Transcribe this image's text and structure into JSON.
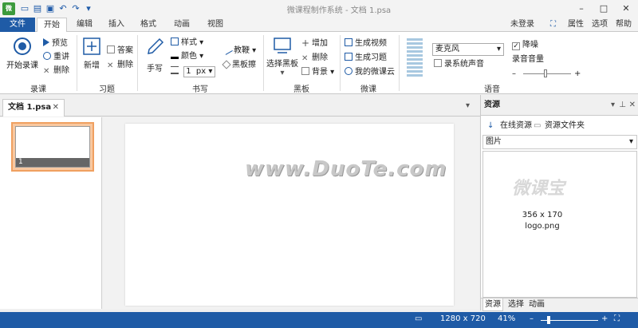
{
  "window": {
    "title": "微课程制作系统 - 文档 1.psa",
    "app_icon": "微",
    "minimize": "–",
    "maximize": "□",
    "close": "✕"
  },
  "tabs": {
    "file": "文件",
    "items": [
      "开始",
      "编辑",
      "插入",
      "格式",
      "动画",
      "视图"
    ],
    "active": "开始",
    "login": "未登录",
    "properties": "属性",
    "options": "选项",
    "help": "帮助"
  },
  "ribbon": {
    "record": {
      "start": "开始录课",
      "preview": "预览",
      "rerecord": "重讲",
      "delete": "删除",
      "label": "录课"
    },
    "exercise": {
      "add": "新增",
      "answer": "答案",
      "delete": "删除",
      "label": "习题"
    },
    "writing": {
      "handwrite": "手写",
      "style": "样式",
      "color": "颜色",
      "size": "1",
      "unit": "px",
      "pointer": "教鞭",
      "eraser": "黑板擦",
      "label": "书写"
    },
    "blackboard": {
      "select": "选择黑板",
      "add": "增加",
      "delete": "删除",
      "background": "背景",
      "label": "黑板"
    },
    "microcourse": {
      "gen_video": "生成视频",
      "gen_exercise": "生成习题",
      "my_cloud": "我的微课云",
      "label": "微课"
    },
    "voice": {
      "mic": "麦克风",
      "record_system": "录系统声音",
      "denoise": "降噪",
      "volume": "录音音量",
      "minus": "–",
      "plus": "+",
      "label": "语音",
      "denoise_checked": true,
      "record_system_checked": false
    }
  },
  "document": {
    "tab": "文档 1.psa",
    "close": "✕",
    "slide_number": "1",
    "watermark": "www.DuoTe.com"
  },
  "panel": {
    "title": "资源",
    "online": "在线资源",
    "folder": "资源文件夹",
    "category": "图片",
    "item_logo_text": "微课宝",
    "item_dim": "356 x 170",
    "item_name": "logo.png",
    "tabs": [
      "资源",
      "选择",
      "动画"
    ],
    "active_tab": "资源"
  },
  "status": {
    "resolution": "1280 x 720",
    "zoom": "41%",
    "zoom_out": "–",
    "zoom_in": "+"
  },
  "colors": {
    "accent": "#1f5ba6",
    "selection": "#f0a060"
  }
}
